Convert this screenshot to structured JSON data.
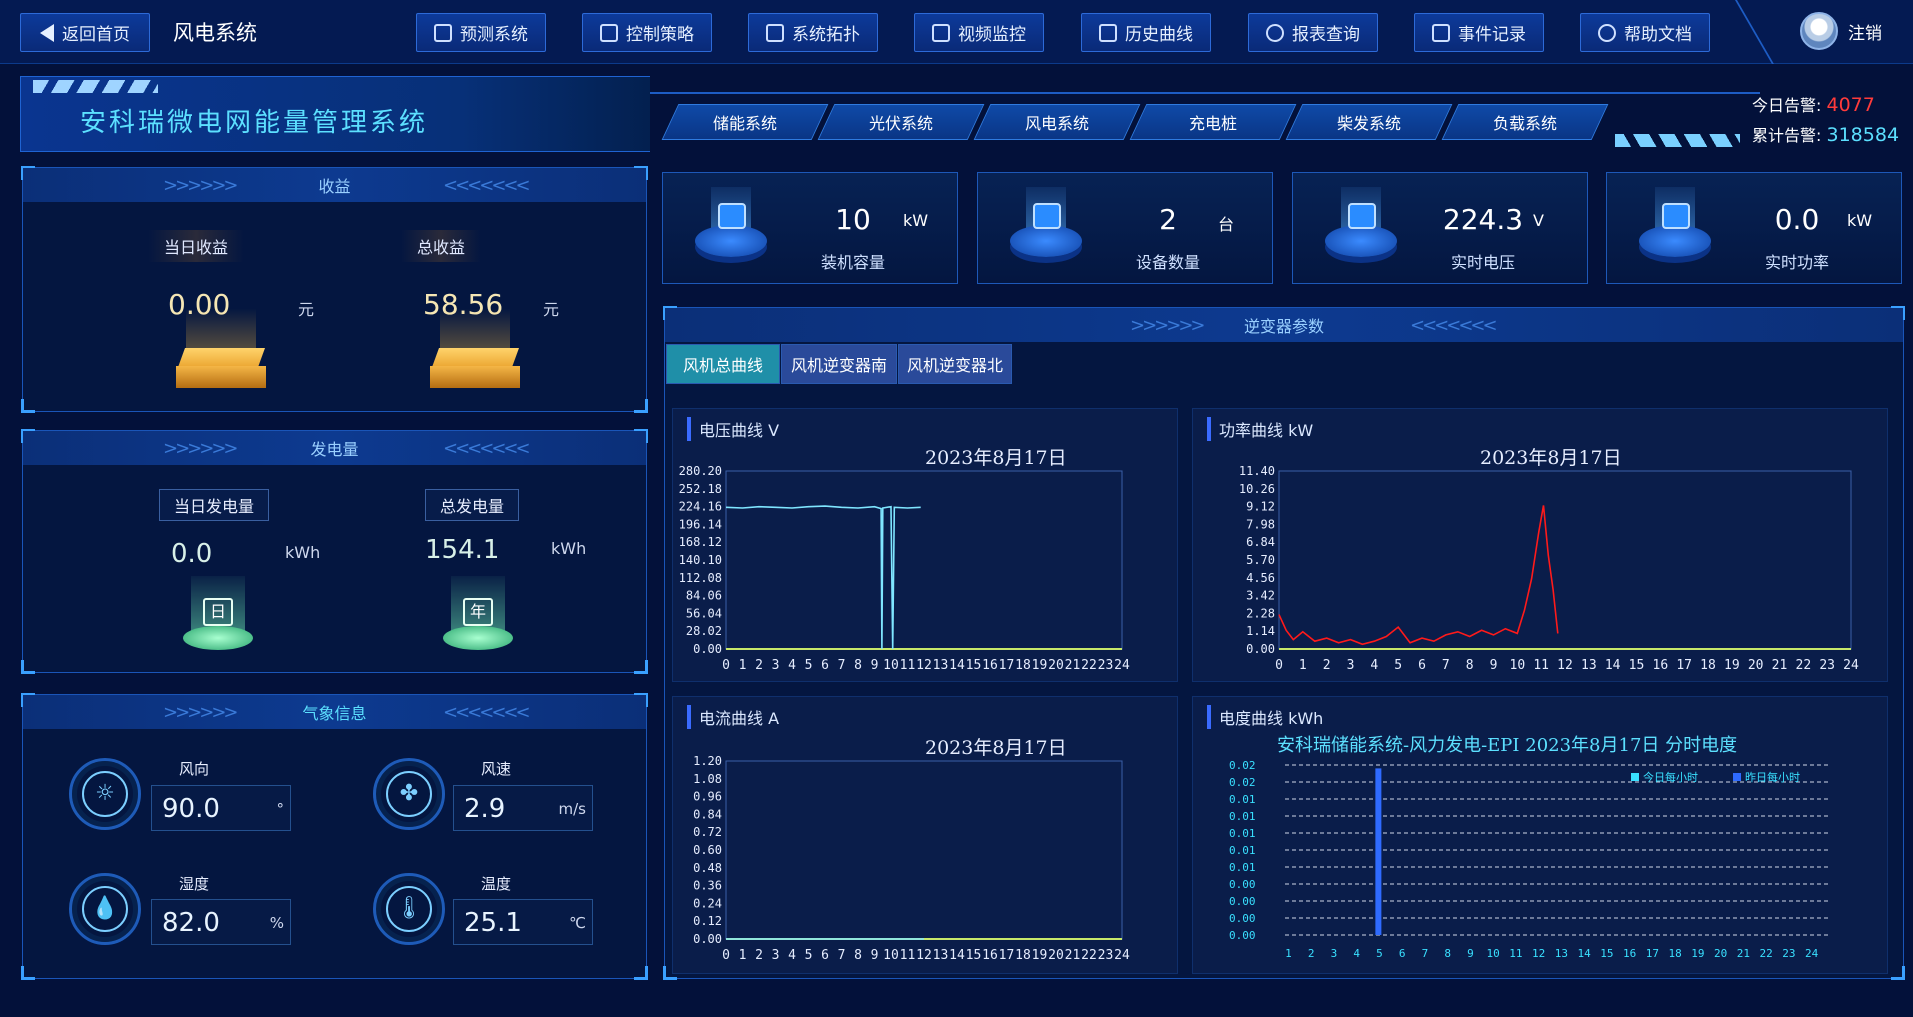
{
  "nav": {
    "back_label": "返回首页",
    "current_system": "风电系统",
    "items": [
      "预测系统",
      "控制策略",
      "系统拓扑",
      "视频监控",
      "历史曲线",
      "报表查询",
      "事件记录",
      "帮助文档"
    ],
    "logout": "注销"
  },
  "header": {
    "title": "安科瑞微电网能量管理系统",
    "tabs": [
      "储能系统",
      "光伏系统",
      "风电系统",
      "充电桩",
      "柴发系统",
      "负载系统"
    ],
    "alarm_today_label": "今日告警:",
    "alarm_today_value": "4077",
    "alarm_total_label": "累计告警:",
    "alarm_total_value": "318584"
  },
  "revenue": {
    "title": "收益",
    "today_label": "当日收益",
    "today_value": "0.00",
    "total_label": "总收益",
    "total_value": "58.56",
    "unit": "元"
  },
  "generation": {
    "title": "发电量",
    "today_label": "当日发电量",
    "today_value": "0.0",
    "total_label": "总发电量",
    "total_value": "154.1",
    "unit": "kWh",
    "day_icon": "日",
    "year_icon": "年"
  },
  "weather": {
    "title": "气象信息",
    "items": [
      {
        "name": "风向",
        "value": "90.0",
        "unit": "°",
        "icon": "sun-icon"
      },
      {
        "name": "风速",
        "value": "2.9",
        "unit": "m/s",
        "icon": "fan-icon"
      },
      {
        "name": "湿度",
        "value": "82.0",
        "unit": "%",
        "icon": "droplet-icon"
      },
      {
        "name": "温度",
        "value": "25.1",
        "unit": "℃",
        "icon": "thermometer-icon"
      }
    ]
  },
  "stats": [
    {
      "value": "10",
      "unit": "kW",
      "label": "装机容量",
      "icon": "battery-icon"
    },
    {
      "value": "2",
      "unit": "台",
      "label": "设备数量",
      "icon": "server-icon"
    },
    {
      "value": "224.3",
      "unit": "V",
      "label": "实时电压",
      "icon": "gauge-icon"
    },
    {
      "value": "0.0",
      "unit": "kW",
      "label": "实时功率",
      "icon": "pulse-icon"
    }
  ],
  "inverter": {
    "title": "逆变器参数",
    "tabs": [
      "风机总曲线",
      "风机逆变器南",
      "风机逆变器北"
    ],
    "active_tab": 0
  },
  "colors": {
    "accent": "#5ce0ff",
    "alarm": "#ff3b3b",
    "alarm_total": "#5ce0ff",
    "voltage_line": "#7fe6ff",
    "power_line": "#ff1a1a",
    "bar": "#2f6bff"
  },
  "chart_data": [
    {
      "type": "line",
      "title": "电压曲线 V",
      "date": "2023年8月17日",
      "x": [
        0,
        1,
        2,
        3,
        4,
        5,
        6,
        7,
        8,
        9,
        10,
        11,
        12,
        13,
        14,
        15,
        16,
        17,
        18,
        19,
        20,
        21,
        22,
        23,
        24
      ],
      "ylim": [
        0,
        280.2
      ],
      "yticks": [
        "0.00",
        "28.02",
        "56.04",
        "84.06",
        "112.08",
        "140.10",
        "168.12",
        "196.14",
        "224.16",
        "252.18",
        "280.20"
      ],
      "series": [
        {
          "values": [
            [
              0,
              223
            ],
            [
              1,
              222
            ],
            [
              2,
              224
            ],
            [
              3,
              223
            ],
            [
              4,
              222
            ],
            [
              5,
              224
            ],
            [
              6,
              225
            ],
            [
              7,
              223
            ],
            [
              8,
              222
            ],
            [
              9,
              224
            ],
            [
              9.4,
              221
            ],
            [
              9.45,
              0
            ],
            [
              9.5,
              222
            ],
            [
              10,
              224
            ],
            [
              10.1,
              0
            ],
            [
              10.2,
              223
            ],
            [
              11,
              222
            ],
            [
              11.8,
              223
            ]
          ]
        }
      ]
    },
    {
      "type": "line",
      "title": "功率曲线 kW",
      "date": "2023年8月17日",
      "x": [
        0,
        1,
        2,
        3,
        4,
        5,
        6,
        7,
        8,
        9,
        10,
        11,
        12,
        13,
        14,
        15,
        16,
        17,
        18,
        19,
        20,
        21,
        22,
        23,
        24
      ],
      "ylim": [
        0,
        11.4
      ],
      "yticks": [
        "0.00",
        "1.14",
        "2.28",
        "3.42",
        "4.56",
        "5.70",
        "6.84",
        "7.98",
        "9.12",
        "10.26",
        "11.40"
      ],
      "series": [
        {
          "values": [
            [
              0,
              2.2
            ],
            [
              0.3,
              1.2
            ],
            [
              0.6,
              0.6
            ],
            [
              1,
              1.1
            ],
            [
              1.5,
              0.5
            ],
            [
              2,
              0.7
            ],
            [
              2.5,
              0.4
            ],
            [
              3,
              0.6
            ],
            [
              3.5,
              0.3
            ],
            [
              4,
              0.5
            ],
            [
              4.5,
              0.8
            ],
            [
              5,
              1.4
            ],
            [
              5.5,
              0.4
            ],
            [
              6,
              0.7
            ],
            [
              6.5,
              0.5
            ],
            [
              7,
              0.9
            ],
            [
              7.5,
              1.1
            ],
            [
              8,
              0.8
            ],
            [
              8.5,
              1.2
            ],
            [
              9,
              0.9
            ],
            [
              9.5,
              1.3
            ],
            [
              10,
              1.0
            ],
            [
              10.3,
              2.5
            ],
            [
              10.6,
              4.5
            ],
            [
              10.9,
              7.5
            ],
            [
              11.1,
              9.2
            ],
            [
              11.3,
              6.0
            ],
            [
              11.5,
              3.8
            ],
            [
              11.7,
              1.0
            ]
          ]
        }
      ]
    },
    {
      "type": "line",
      "title": "电流曲线 A",
      "date": "2023年8月17日",
      "x": [
        0,
        1,
        2,
        3,
        4,
        5,
        6,
        7,
        8,
        9,
        10,
        11,
        12,
        13,
        14,
        15,
        16,
        17,
        18,
        19,
        20,
        21,
        22,
        23,
        24
      ],
      "ylim": [
        0,
        1.2
      ],
      "yticks": [
        "0.00",
        "0.12",
        "0.24",
        "0.36",
        "0.48",
        "0.60",
        "0.72",
        "0.84",
        "0.96",
        "1.08",
        "1.20"
      ],
      "series": [
        {
          "values": [
            [
              0,
              0
            ],
            [
              12,
              0
            ]
          ]
        }
      ]
    },
    {
      "type": "bar",
      "title": "电度曲线 kWh",
      "subtitle": "安科瑞储能系统-风力发电-EPI 2023年8月17日 分时电度",
      "categories": [
        "1",
        "2",
        "3",
        "4",
        "5",
        "6",
        "7",
        "8",
        "9",
        "10",
        "11",
        "12",
        "13",
        "14",
        "15",
        "16",
        "17",
        "18",
        "19",
        "20",
        "21",
        "22",
        "23",
        "24"
      ],
      "yticks": [
        "0.00",
        "0.00",
        "0.00",
        "0.00",
        "0.01",
        "0.01",
        "0.01",
        "0.01",
        "0.01",
        "0.02",
        "0.02"
      ],
      "ylim": [
        0,
        0.02
      ],
      "legend": [
        "今日每小时",
        "昨日每小时"
      ],
      "series": [
        {
          "name": "今日每小时",
          "values": [
            0,
            0,
            0,
            0,
            0.0196,
            0,
            0,
            0,
            0,
            0,
            0,
            0,
            0,
            0,
            0,
            0,
            0,
            0,
            0,
            0,
            0,
            0,
            0,
            0
          ]
        }
      ]
    }
  ]
}
